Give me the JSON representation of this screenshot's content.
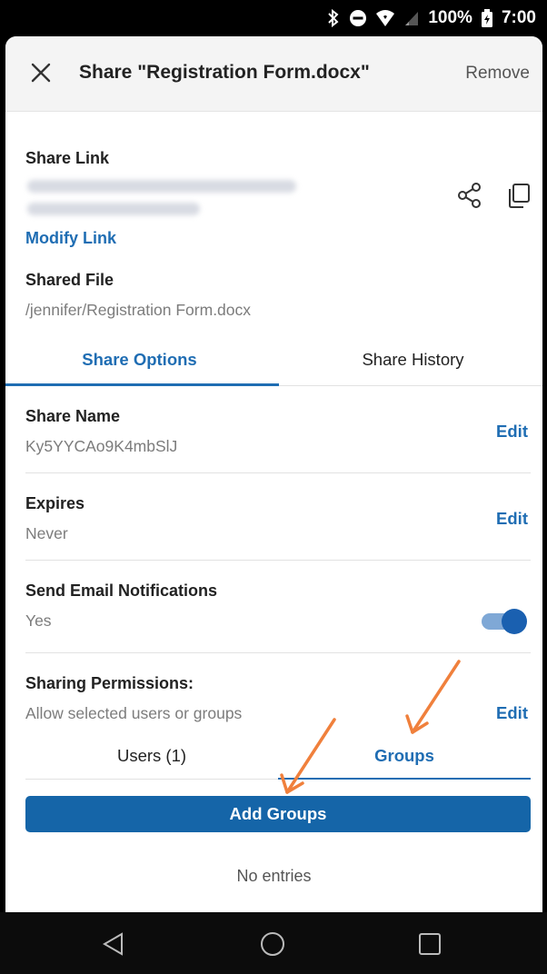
{
  "status_bar": {
    "battery": "100%",
    "time": "7:00"
  },
  "header": {
    "title": "Share \"Registration Form.docx\"",
    "remove_label": "Remove"
  },
  "share_link": {
    "label": "Share Link",
    "modify_label": "Modify Link"
  },
  "shared_file": {
    "label": "Shared File",
    "path": "/jennifer/Registration Form.docx"
  },
  "tabs": [
    {
      "label": "Share Options",
      "active": true
    },
    {
      "label": "Share History",
      "active": false
    }
  ],
  "options": {
    "share_name": {
      "label": "Share Name",
      "value": "Ky5YYCAo9K4mbSlJ",
      "action": "Edit"
    },
    "expires": {
      "label": "Expires",
      "value": "Never",
      "action": "Edit"
    },
    "email_notifications": {
      "label": "Send Email Notifications",
      "value": "Yes",
      "enabled": true
    },
    "sharing_permissions": {
      "label": "Sharing Permissions:",
      "value": "Allow selected users or groups",
      "action": "Edit"
    }
  },
  "subtabs": [
    {
      "label": "Users (1)",
      "active": false
    },
    {
      "label": "Groups",
      "active": true
    }
  ],
  "add_button_label": "Add Groups",
  "empty_text": "No entries",
  "colors": {
    "accent": "#1f6db3",
    "button": "#1565a8",
    "annotation_arrow": "#f0803c"
  }
}
